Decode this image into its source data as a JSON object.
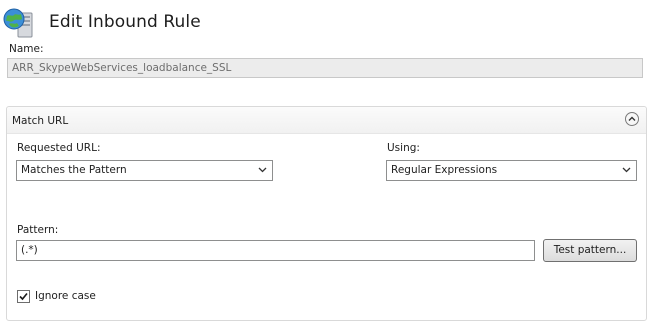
{
  "header": {
    "title": "Edit Inbound Rule",
    "icon": "globe-server-icon"
  },
  "name": {
    "label": "Name:",
    "value": "ARR_SkypeWebServices_loadbalance_SSL"
  },
  "match_url": {
    "title": "Match URL",
    "collapse_icon": "chevron-up-icon",
    "requested_url": {
      "label": "Requested URL:",
      "selected": "Matches the Pattern"
    },
    "using": {
      "label": "Using:",
      "selected": "Regular Expressions"
    },
    "pattern": {
      "label": "Pattern:",
      "value": "(.*)"
    },
    "test_button": "Test pattern...",
    "ignore_case": {
      "label": "Ignore case",
      "checked": true
    }
  }
}
